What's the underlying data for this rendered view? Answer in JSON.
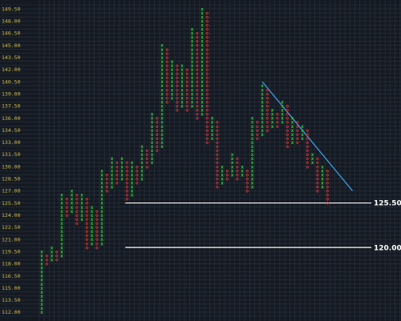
{
  "chart_data": {
    "type": "point-and-figure",
    "y_tick_labels": [
      "112.00",
      "113.50",
      "115.00",
      "116.50",
      "118.00",
      "119.50",
      "121.00",
      "122.50",
      "124.00",
      "125.50",
      "127.00",
      "128.50",
      "130.00",
      "131.50",
      "133.00",
      "134.50",
      "136.00",
      "137.50",
      "139.00",
      "140.50",
      "142.00",
      "143.50",
      "145.00",
      "146.50",
      "148.00",
      "149.50"
    ],
    "ylim": [
      111.5,
      150
    ],
    "box_size": 0.5,
    "colors": {
      "x": "#2fcf3a",
      "o": "#d23a3a",
      "support": "#ffffff",
      "trendline": "#3aa0e6",
      "background": "#151a22",
      "ticks": "#c9b84a"
    },
    "support_levels": [
      {
        "label": "125.50",
        "value": 125.5,
        "from_column": 17
      },
      {
        "label": "120.00",
        "value": 120.0,
        "from_column": 17
      }
    ],
    "trendline": {
      "from": [
        44,
        140.5
      ],
      "to": [
        62,
        127.0
      ]
    },
    "columns": [
      {
        "type": "X",
        "from": 112.0,
        "to": 119.5
      },
      {
        "type": "O",
        "from": 118.0,
        "to": 119.0
      },
      {
        "type": "X",
        "from": 118.5,
        "to": 120.0
      },
      {
        "type": "O",
        "from": 118.5,
        "to": 119.5
      },
      {
        "type": "X",
        "from": 119.0,
        "to": 126.5
      },
      {
        "type": "O",
        "from": 124.0,
        "to": 126.0
      },
      {
        "type": "X",
        "from": 124.5,
        "to": 127.0
      },
      {
        "type": "O",
        "from": 123.0,
        "to": 126.5
      },
      {
        "type": "X",
        "from": 123.5,
        "to": 126.5
      },
      {
        "type": "O",
        "from": 120.0,
        "to": 126.0
      },
      {
        "type": "X",
        "from": 120.5,
        "to": 125.0
      },
      {
        "type": "O",
        "from": 120.0,
        "to": 124.5
      },
      {
        "type": "X",
        "from": 120.5,
        "to": 129.5
      },
      {
        "type": "O",
        "from": 127.0,
        "to": 129.0
      },
      {
        "type": "X",
        "from": 127.5,
        "to": 131.0
      },
      {
        "type": "O",
        "from": 128.0,
        "to": 130.5
      },
      {
        "type": "X",
        "from": 128.5,
        "to": 131.0
      },
      {
        "type": "O",
        "from": 126.0,
        "to": 130.5
      },
      {
        "type": "X",
        "from": 126.5,
        "to": 130.5
      },
      {
        "type": "O",
        "from": 128.0,
        "to": 130.0
      },
      {
        "type": "X",
        "from": 128.5,
        "to": 132.5
      },
      {
        "type": "O",
        "from": 130.0,
        "to": 132.0
      },
      {
        "type": "X",
        "from": 130.5,
        "to": 136.5
      },
      {
        "type": "O",
        "from": 132.0,
        "to": 136.0
      },
      {
        "type": "X",
        "from": 132.5,
        "to": 145.0
      },
      {
        "type": "O",
        "from": 138.0,
        "to": 144.5
      },
      {
        "type": "X",
        "from": 138.5,
        "to": 143.0
      },
      {
        "type": "O",
        "from": 137.0,
        "to": 142.5
      },
      {
        "type": "X",
        "from": 137.5,
        "to": 142.5
      },
      {
        "type": "O",
        "from": 137.0,
        "to": 142.0
      },
      {
        "type": "X",
        "from": 137.5,
        "to": 147.0
      },
      {
        "type": "O",
        "from": 136.0,
        "to": 146.5
      },
      {
        "type": "X",
        "from": 136.5,
        "to": 149.5
      },
      {
        "type": "O",
        "from": 133.0,
        "to": 149.0
      },
      {
        "type": "X",
        "from": 133.5,
        "to": 136.0
      },
      {
        "type": "O",
        "from": 127.5,
        "to": 135.5
      },
      {
        "type": "X",
        "from": 128.0,
        "to": 130.0
      },
      {
        "type": "O",
        "from": 128.5,
        "to": 129.5
      },
      {
        "type": "X",
        "from": 129.0,
        "to": 131.5
      },
      {
        "type": "O",
        "from": 128.5,
        "to": 131.0
      },
      {
        "type": "X",
        "from": 129.0,
        "to": 130.0
      },
      {
        "type": "O",
        "from": 127.0,
        "to": 129.5
      },
      {
        "type": "X",
        "from": 127.5,
        "to": 136.0
      },
      {
        "type": "O",
        "from": 133.5,
        "to": 135.5
      },
      {
        "type": "X",
        "from": 134.0,
        "to": 140.0
      },
      {
        "type": "O",
        "from": 134.5,
        "to": 139.5
      },
      {
        "type": "X",
        "from": 135.0,
        "to": 137.0
      },
      {
        "type": "O",
        "from": 135.0,
        "to": 136.5
      },
      {
        "type": "X",
        "from": 135.5,
        "to": 138.0
      },
      {
        "type": "O",
        "from": 132.5,
        "to": 137.5
      },
      {
        "type": "X",
        "from": 133.0,
        "to": 136.0
      },
      {
        "type": "O",
        "from": 133.0,
        "to": 135.5
      },
      {
        "type": "X",
        "from": 133.5,
        "to": 135.0
      },
      {
        "type": "O",
        "from": 130.0,
        "to": 134.5
      },
      {
        "type": "X",
        "from": 130.5,
        "to": 131.5
      },
      {
        "type": "O",
        "from": 127.0,
        "to": 131.0
      },
      {
        "type": "X",
        "from": 127.5,
        "to": 130.0
      },
      {
        "type": "O",
        "from": 125.5,
        "to": 129.5
      }
    ]
  }
}
